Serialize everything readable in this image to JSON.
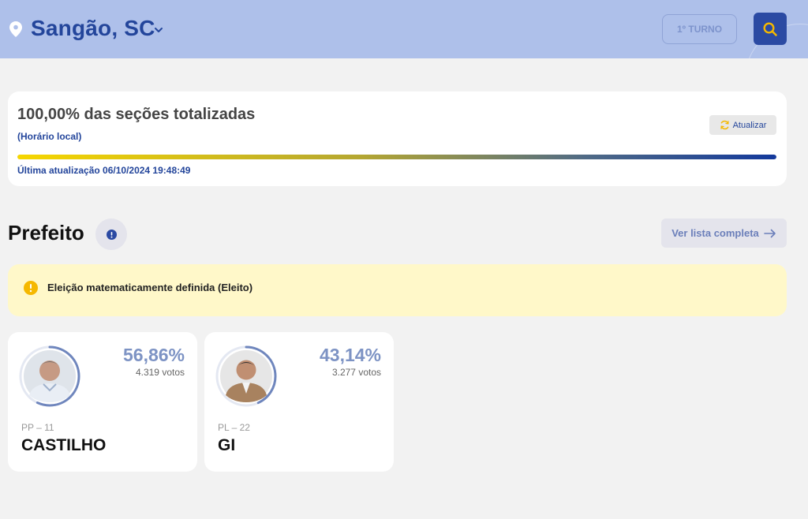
{
  "header": {
    "location": "Sangão, SC",
    "round_label": "1º TURNO",
    "colors": {
      "bg": "#aec0ea",
      "primary": "#23459b",
      "search_bg": "#2b4aa3",
      "search_icon": "#f5b800"
    }
  },
  "progress": {
    "title": "100,00% das seções totalizadas",
    "local_time_note": "(Horário local)",
    "update_label": "Atualizar",
    "percent": 100,
    "last_update": "Última atualização 06/10/2024 19:48:49"
  },
  "office": {
    "title": "Prefeito",
    "view_all_label": "Ver lista completa"
  },
  "alert": {
    "text": "Eleição matematicamente definida (Eleito)",
    "color": "#f5b800"
  },
  "candidates": [
    {
      "party": "PP – 11",
      "name": "CASTILHO",
      "percent": "56,86%",
      "votes": "4.319 votos",
      "share": 0.5686
    },
    {
      "party": "PL – 22",
      "name": "GI",
      "percent": "43,14%",
      "votes": "3.277 votos",
      "share": 0.4314
    }
  ],
  "icons": [
    "location-pin-icon",
    "chevron-down-icon",
    "search-icon",
    "refresh-icon",
    "info-icon",
    "arrow-right-icon",
    "alert-info-icon"
  ]
}
